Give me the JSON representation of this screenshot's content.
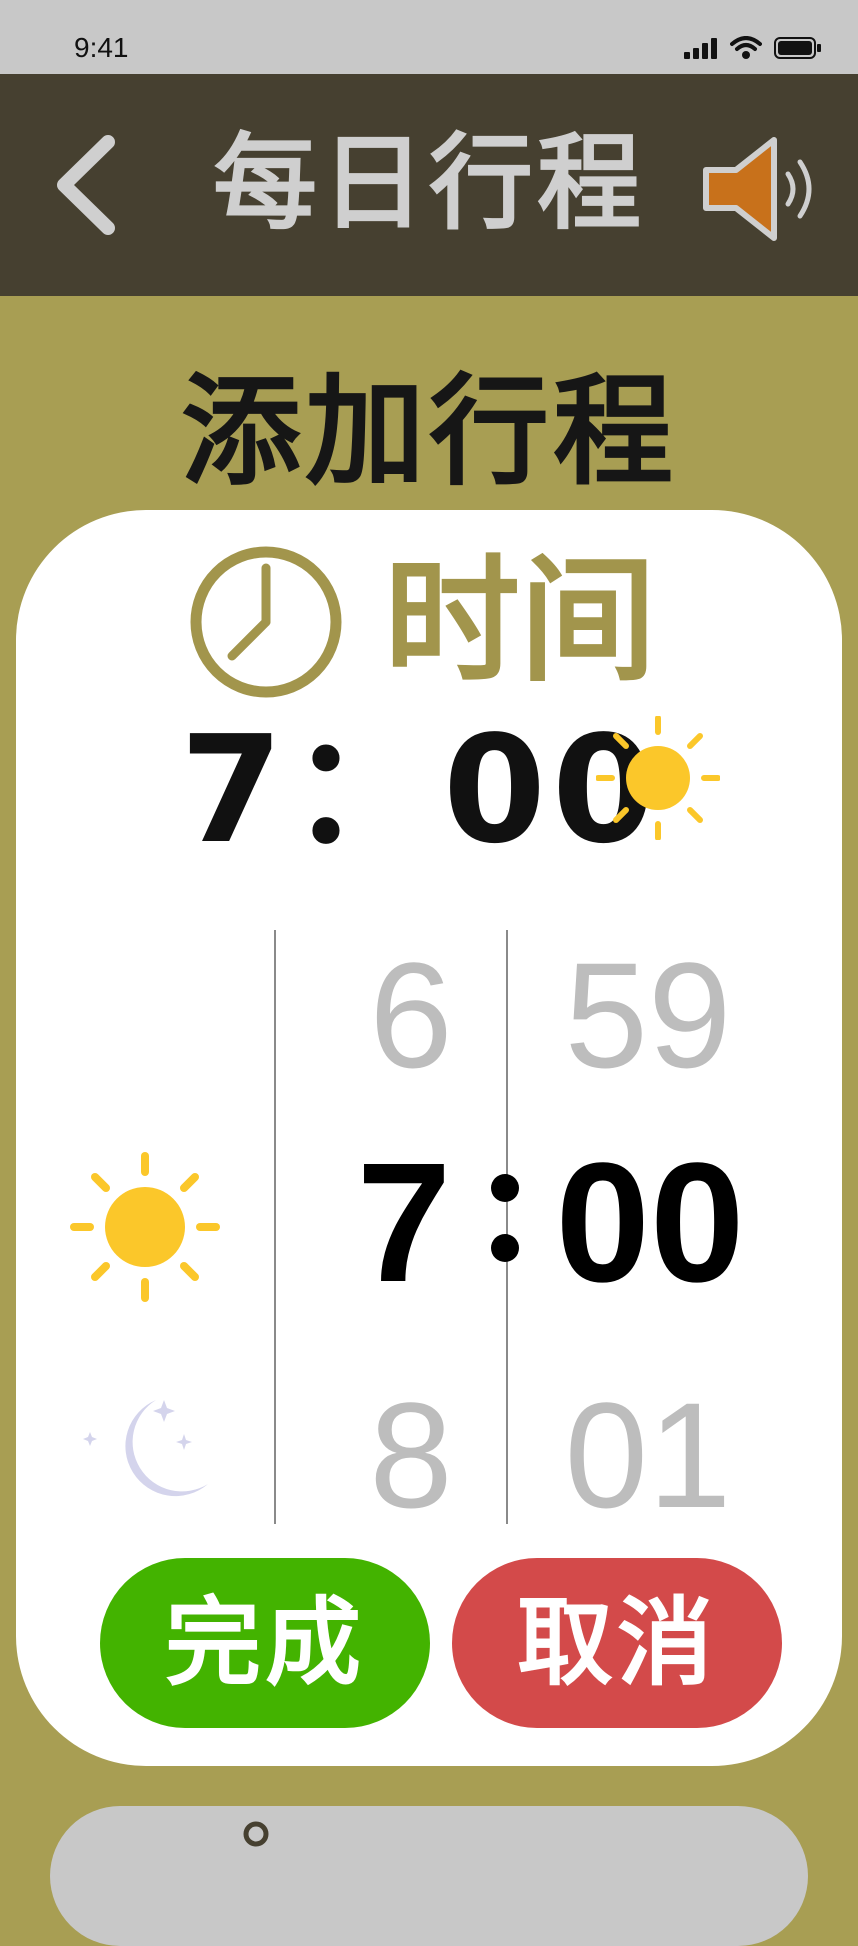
{
  "status_bar": {
    "time": "9:41"
  },
  "header": {
    "title": "每日行程",
    "back_icon": "chevron-left-icon",
    "speaker_icon": "speaker-icon"
  },
  "page": {
    "title": "添加行程"
  },
  "time_card": {
    "label": "时间",
    "selected_time_display": "7：00",
    "period_icon": "sun-icon",
    "picker": {
      "hour_above": "6",
      "hour_selected": "7",
      "hour_below": "8",
      "minute_above": "59",
      "minute_selected": "00",
      "minute_below": "01",
      "period_selected_icon": "sun-icon",
      "period_other_icon": "moon-icon"
    },
    "done_label": "完成",
    "cancel_label": "取消"
  },
  "colors": {
    "background": "#a89e53",
    "header": "#464030",
    "accent": "#a2954c",
    "done": "#43b300",
    "cancel": "#d34a4a",
    "sun": "#fbc72a",
    "speaker": "#c8711b"
  }
}
